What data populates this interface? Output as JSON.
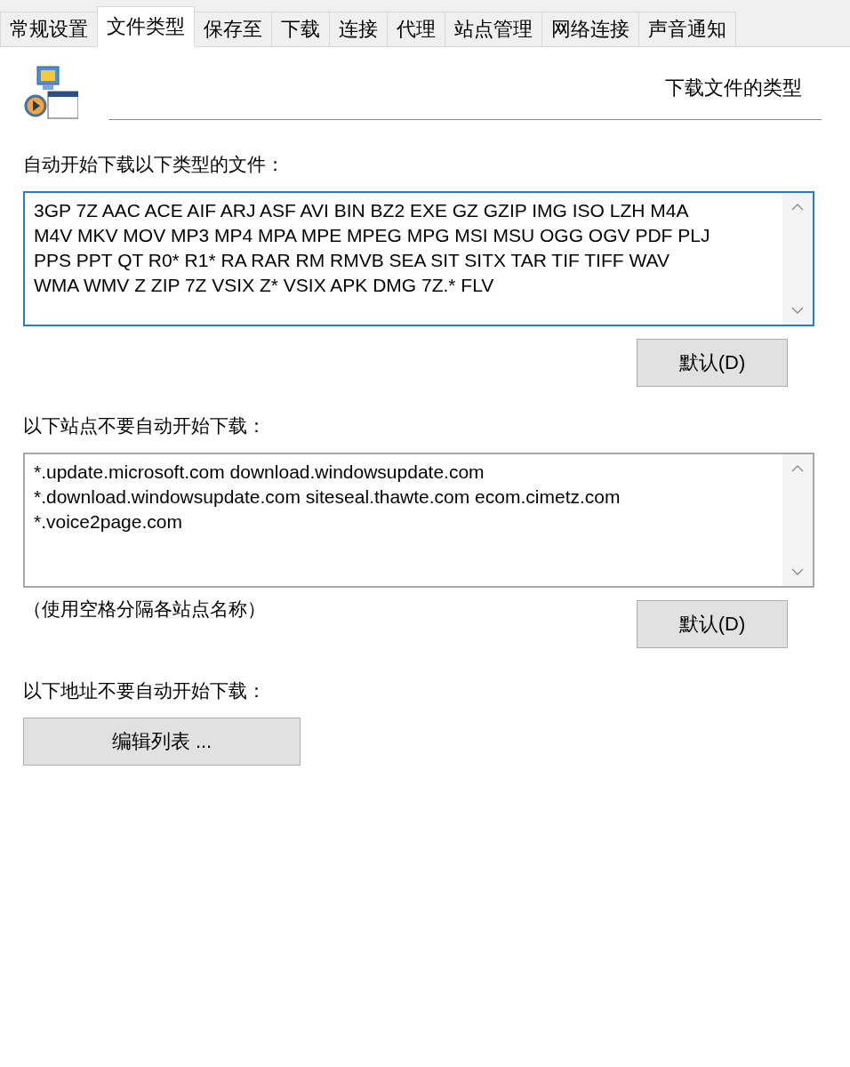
{
  "tabs": [
    {
      "label": "常规设置",
      "selected": false
    },
    {
      "label": "文件类型",
      "selected": true
    },
    {
      "label": "保存至",
      "selected": false
    },
    {
      "label": "下载",
      "selected": false
    },
    {
      "label": "连接",
      "selected": false
    },
    {
      "label": "代理",
      "selected": false
    },
    {
      "label": "站点管理",
      "selected": false
    },
    {
      "label": "网络连接",
      "selected": false
    },
    {
      "label": "声音通知",
      "selected": false
    }
  ],
  "header": {
    "title": "下载文件的类型"
  },
  "file_types": {
    "label": "自动开始下载以下类型的文件：",
    "value": [
      "3GP 7Z AAC ACE AIF ARJ ASF AVI BIN BZ2 EXE GZ GZIP IMG ISO LZH M4A",
      "M4V MKV MOV MP3 MP4 MPA MPE MPEG MPG MSI MSU OGG OGV PDF PLJ",
      "PPS PPT QT R0* R1* RA RAR RM RMVB SEA SIT SITX TAR TIF TIFF WAV",
      "WMA WMV Z ZIP 7Z VSIX Z* VSIX APK DMG 7Z.* FLV"
    ],
    "focused": true,
    "button": "默认(D)"
  },
  "sites": {
    "label": "以下站点不要自动开始下载：",
    "value": [
      "*.update.microsoft.com download.windowsupdate.com",
      "*.download.windowsupdate.com siteseal.thawte.com ecom.cimetz.com",
      "*.voice2page.com"
    ],
    "focused": false,
    "hint": "（使用空格分隔各站点名称）",
    "button": "默认(D)"
  },
  "addresses": {
    "label": "以下地址不要自动开始下载：",
    "button": "编辑列表 ..."
  }
}
